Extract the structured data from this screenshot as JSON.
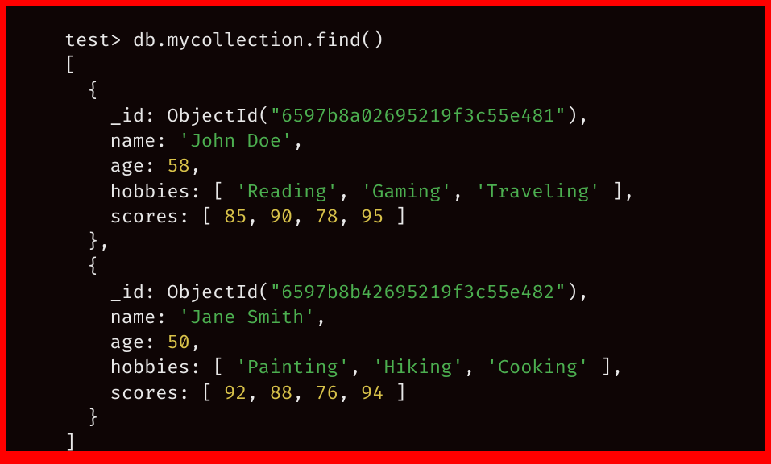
{
  "prompt": "test>",
  "command": "db.mycollection.find()",
  "open_bracket": "[",
  "close_bracket": "]",
  "objectid_label": "ObjectId",
  "docs": [
    {
      "id_key": "_id",
      "id_value": "\"6597b8a02695219f3c55e481\"",
      "name_key": "name",
      "name_value": "'John Doe'",
      "age_key": "age",
      "age_value": "58",
      "hobbies_key": "hobbies",
      "hobbies": [
        "'Reading'",
        "'Gaming'",
        "'Traveling'"
      ],
      "scores_key": "scores",
      "scores": [
        "85",
        "90",
        "78",
        "95"
      ]
    },
    {
      "id_key": "_id",
      "id_value": "\"6597b8b42695219f3c55e482\"",
      "name_key": "name",
      "name_value": "'Jane Smith'",
      "age_key": "age",
      "age_value": "50",
      "hobbies_key": "hobbies",
      "hobbies": [
        "'Painting'",
        "'Hiking'",
        "'Cooking'"
      ],
      "scores_key": "scores",
      "scores": [
        "92",
        "88",
        "76",
        "94"
      ]
    }
  ]
}
